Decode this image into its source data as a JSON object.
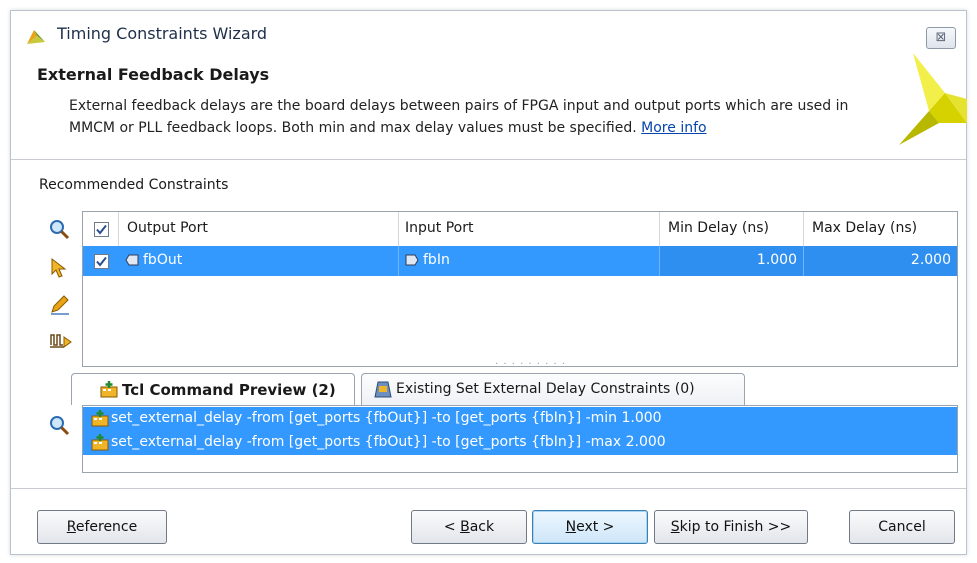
{
  "window": {
    "title": "Timing Constraints Wizard",
    "close_label": "⊠"
  },
  "header": {
    "title": "External Feedback Delays",
    "description": "External feedback delays are the board delays between pairs of FPGA input and output ports which are used in MMCM or PLL feedback loops. Both min and max delay values must be specified.",
    "more_info_label": "More info"
  },
  "constraints": {
    "section_label": "Recommended Constraints",
    "columns": [
      "Output Port",
      "Input Port",
      "Min Delay (ns)",
      "Max Delay (ns)"
    ],
    "header_checked": true,
    "rows": [
      {
        "checked": true,
        "output_port": "fbOut",
        "input_port": "fbIn",
        "min_delay": "1.000",
        "max_delay": "2.000",
        "selected": true
      }
    ],
    "toolbar_icons": [
      "search-icon",
      "select-cursor-icon",
      "edit-pencil-icon",
      "apply-wave-icon"
    ]
  },
  "tabs": [
    {
      "label": "Tcl Command Preview (2)",
      "active": true
    },
    {
      "label": "Existing Set External Delay Constraints (0)",
      "active": false
    }
  ],
  "tcl_preview": {
    "lines": [
      "set_external_delay -from [get_ports {fbOut}] -to [get_ports {fbIn}] -min 1.000",
      "set_external_delay -from [get_ports {fbOut}] -to [get_ports {fbIn}] -max 2.000"
    ]
  },
  "buttons": {
    "reference": {
      "prefix": "",
      "accel": "R",
      "rest": "eference"
    },
    "back": {
      "prefix": "< ",
      "accel": "B",
      "rest": "ack"
    },
    "next": {
      "prefix": "",
      "accel": "N",
      "rest": "ext >"
    },
    "skip": {
      "prefix": "",
      "accel": "S",
      "rest": "kip to Finish >>"
    },
    "cancel": {
      "prefix": "",
      "accel": "",
      "rest": "Cancel"
    }
  },
  "colors": {
    "selection": "#3399ff",
    "link": "#0645ad",
    "logo_yellow": "#d6d200"
  }
}
